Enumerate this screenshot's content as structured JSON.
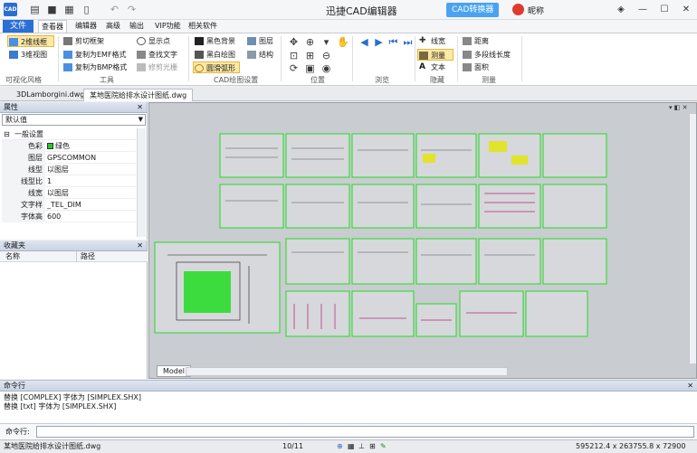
{
  "titlebar": {
    "app_logo": "CAD",
    "title": "迅捷CAD编辑器",
    "converter_label": "CAD转换器",
    "user_name": "昵称",
    "quick_access": [
      "folder-icon",
      "save-icon",
      "print-icon",
      "page-icon",
      "undo-icon",
      "redo-icon"
    ],
    "window_buttons": [
      "restore-icon",
      "minimize-icon",
      "maximize-icon",
      "close-icon"
    ]
  },
  "menu": {
    "file": "文件",
    "tabs": [
      "查看器",
      "编辑器",
      "高级",
      "输出",
      "VIP功能",
      "相关软件"
    ],
    "active_tab": 0
  },
  "ribbon": {
    "visual_style": {
      "btn_2d": "2维线框",
      "btn_3d": "3维视图",
      "group": "可视化风格"
    },
    "tools": {
      "col1": [
        "剪切框架",
        "复制为EMF格式",
        "复制为BMP格式"
      ],
      "col2": [
        "显示点",
        "查找文字",
        "修剪光栅"
      ],
      "group": "工具"
    },
    "cad_settings": {
      "col1": [
        "黑色背景",
        "黑白绘图",
        "圆滑弧形"
      ],
      "col2": [
        "图层",
        "结构"
      ],
      "group": "CAD绘图设置"
    },
    "position_group": "位置",
    "browse_group": "浏览",
    "hide": {
      "items": [
        "线宽",
        "测量",
        "文本"
      ],
      "group": "隐藏"
    },
    "measure": {
      "items": [
        "距离",
        "多段线长度",
        "面积"
      ],
      "group": "测量"
    }
  },
  "doctabs": [
    "3DLamborgini.dwg",
    "某地医院给排水设计图纸.dwg"
  ],
  "props": {
    "title": "属性",
    "select_value": "默认值",
    "section": "一般设置",
    "rows": [
      {
        "k": "色彩",
        "v": "绿色"
      },
      {
        "k": "图层",
        "v": "GPSCOMMON"
      },
      {
        "k": "线型",
        "v": "以图层"
      },
      {
        "k": "线型比",
        "v": "1"
      },
      {
        "k": "线宽",
        "v": "以图层"
      },
      {
        "k": "文字样",
        "v": "_TEL_DIM"
      },
      {
        "k": "字体高",
        "v": "600"
      }
    ],
    "color_swatch": "#22cc22"
  },
  "favorites": {
    "title": "收藏夹",
    "col_name": "名称",
    "col_path": "路径"
  },
  "canvas": {
    "model_tab": "Model",
    "bg": "#c9ccd0",
    "frame_color": "#22dd22"
  },
  "command": {
    "title": "命令行",
    "history": [
      "替换 [COMPLEX] 字体为 [SIMPLEX.SHX]",
      "替换 [txt] 字体为 [SIMPLEX.SHX]"
    ],
    "label": "命令行:"
  },
  "status": {
    "file": "某地医院给排水设计图纸.dwg",
    "page": "10/11",
    "coords": "595212.4 x 263755.8 x 72900"
  }
}
